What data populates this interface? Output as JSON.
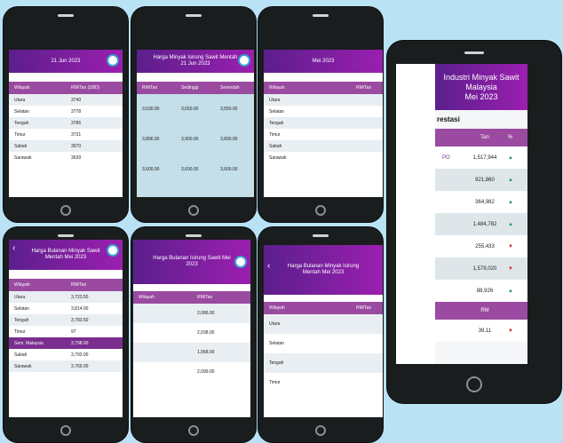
{
  "phones": [
    {
      "header": "21 Jun 2023",
      "columns": [
        "Wilayah",
        "RM/Tan (SBD)"
      ],
      "rows": [
        [
          "Utara",
          "3740"
        ],
        [
          "Selatan",
          "3778"
        ],
        [
          "Tengah",
          "3786"
        ],
        [
          "Timur",
          "3731"
        ],
        [
          "Sabah",
          "3570"
        ],
        [
          "Sarawak",
          "3639"
        ]
      ]
    },
    {
      "header": "Harga Minyak Isirung Sawit Mentah 21 Jun 2023",
      "columns": [
        "RM/Tan",
        "Sedinggi",
        "Serendah"
      ],
      "rows": [
        [
          "3,630.00",
          "3,650.00",
          "3,550.00"
        ],
        [
          "",
          "",
          ""
        ],
        [
          "3,896.00",
          "3,900.00",
          "3,890.00"
        ],
        [
          "",
          "",
          ""
        ],
        [
          "3,600.00",
          "3,600.00",
          "3,600.00"
        ]
      ]
    },
    {
      "header": "Mei 2023",
      "columns": [
        "Wilayah",
        "RM/Tan"
      ],
      "rows": [
        [
          "Utara",
          ""
        ],
        [
          "Selatan",
          ""
        ],
        [
          "Tengah",
          ""
        ],
        [
          "Timur",
          ""
        ],
        [
          "Sabah",
          ""
        ],
        [
          "Sarawak",
          ""
        ]
      ]
    },
    {
      "header": "Harga Bulanan Minyak Sawit Mentah Mei 2023",
      "columns": [
        "Wilayah",
        "RM/Tan"
      ],
      "rows": [
        [
          "Utara",
          "3,723.50"
        ],
        [
          "Selatan",
          "3,814.00"
        ],
        [
          "Tengah",
          "3,783.50"
        ],
        [
          "Timur",
          "97"
        ],
        [
          "Sem. Malaysia",
          "3,798.00"
        ],
        [
          "Sabah",
          "3,793.00"
        ],
        [
          "Sarawak",
          "3,765.00"
        ]
      ]
    },
    {
      "header": "Harga Bulanan Isirung Sawit Mei 2023",
      "columns": [
        "Wilayah",
        "RM/Tan"
      ],
      "rows": [
        [
          "",
          "2,086.00"
        ],
        [
          "",
          "2,038.00"
        ],
        [
          "",
          "1,968.00"
        ],
        [
          "",
          "2,099.00"
        ]
      ]
    },
    {
      "header": "Harga Bulanan Minyak Isirung Mentah Mei 2023",
      "columns": [
        "Wilayah",
        "RM/Tan"
      ],
      "rows": [
        [
          "Utara",
          ""
        ],
        [
          "Selatan",
          ""
        ],
        [
          "Tengah",
          ""
        ],
        [
          "Timur",
          ""
        ]
      ]
    }
  ],
  "big": {
    "header_line1": "Industri Minyak Sawit Malaysia",
    "header_line2": "Mei 2023",
    "subtitle": "restasi",
    "columns": [
      "Tan",
      "%"
    ],
    "rows": [
      {
        "label": "PO",
        "value": "1,517,944",
        "trend": "up"
      },
      {
        "label": "",
        "value": "921,860",
        "trend": "up"
      },
      {
        "label": "",
        "value": "364,982",
        "trend": "up"
      },
      {
        "label": "",
        "value": "1,484,782",
        "trend": "up"
      },
      {
        "label": "",
        "value": "255,433",
        "trend": "down"
      },
      {
        "label": "",
        "value": "1,579,020",
        "trend": "down"
      },
      {
        "label": "",
        "value": "88,926",
        "trend": "up"
      }
    ],
    "subheader": "RM",
    "last_row": {
      "value": "39.11",
      "trend": "down"
    },
    "up_glyph": "▲",
    "down_glyph": "▼"
  }
}
